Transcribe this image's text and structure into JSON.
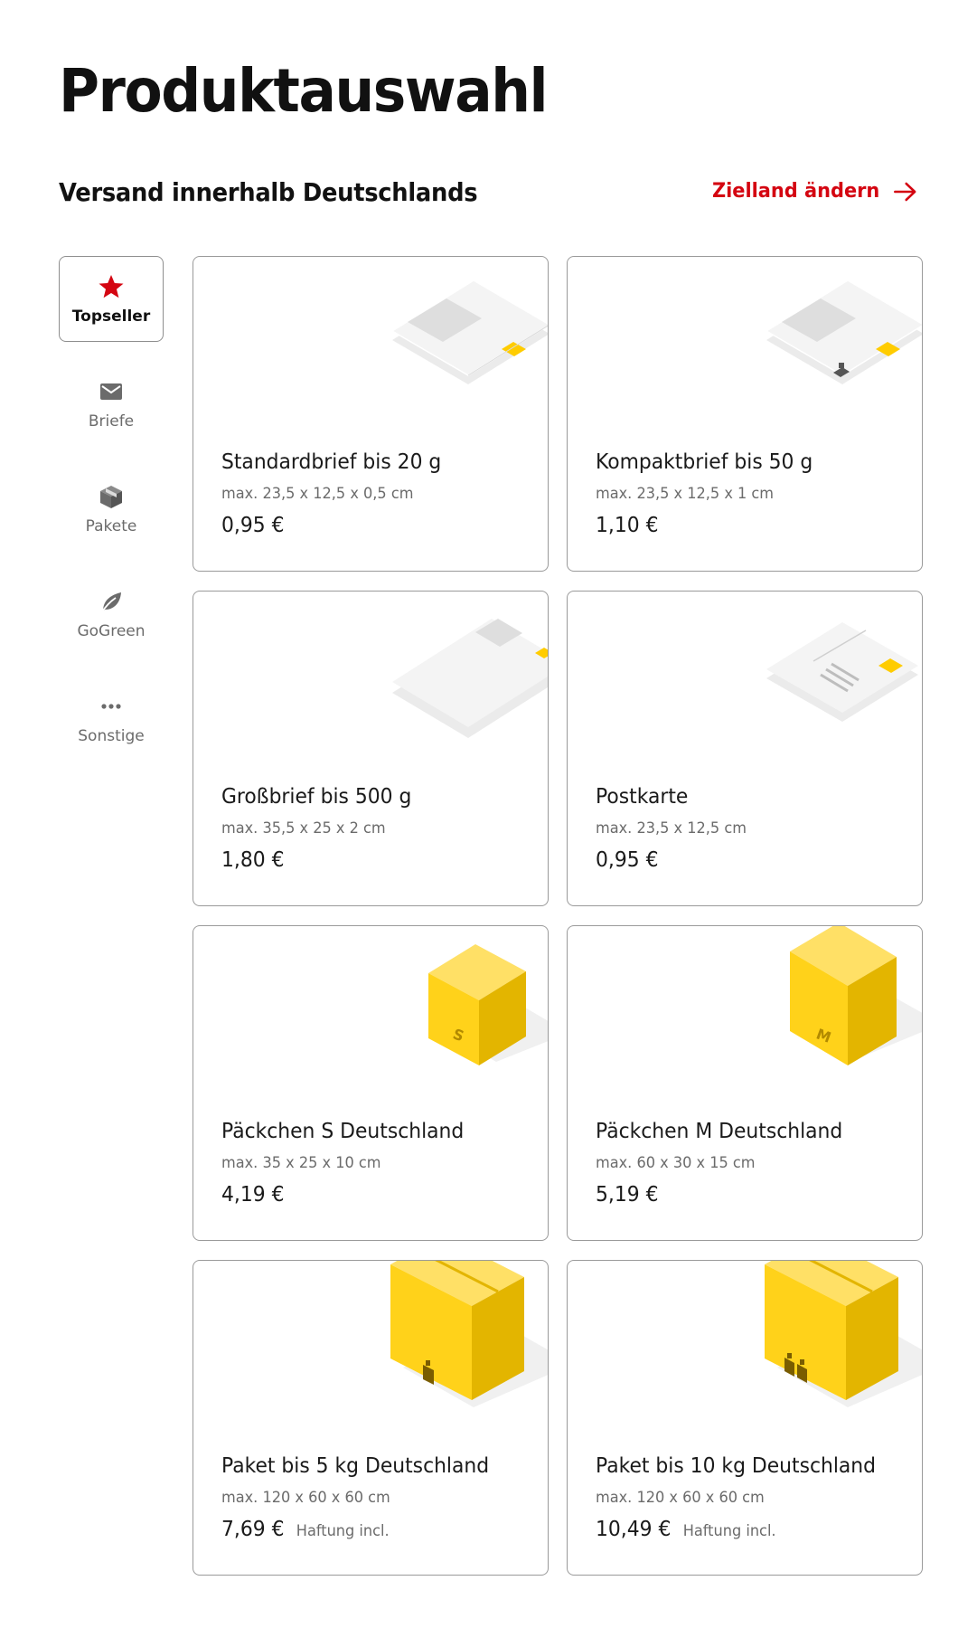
{
  "page": {
    "title": "Produktauswahl"
  },
  "section": {
    "title": "Versand innerhalb Deutschlands",
    "change_destination": "Zielland ändern"
  },
  "sidebar": {
    "items": [
      {
        "label": "Topseller",
        "icon": "star-icon",
        "active": true
      },
      {
        "label": "Briefe",
        "icon": "envelope-icon",
        "active": false
      },
      {
        "label": "Pakete",
        "icon": "package-icon",
        "active": false
      },
      {
        "label": "GoGreen",
        "icon": "leaf-icon",
        "active": false
      },
      {
        "label": "Sonstige",
        "icon": "more-icon",
        "active": false
      }
    ]
  },
  "products": [
    {
      "name": "Standardbrief bis 20 g",
      "dims": "max. 23,5 x 12,5 x 0,5 cm",
      "price": "0,95 €",
      "note": ""
    },
    {
      "name": "Kompaktbrief bis 50 g",
      "dims": "max. 23,5 x 12,5 x 1 cm",
      "price": "1,10 €",
      "note": ""
    },
    {
      "name": "Großbrief bis 500 g",
      "dims": "max. 35,5 x 25 x 2 cm",
      "price": "1,80 €",
      "note": ""
    },
    {
      "name": "Postkarte",
      "dims": "max. 23,5 x 12,5 cm",
      "price": "0,95 €",
      "note": ""
    },
    {
      "name": "Päckchen S Deutschland",
      "dims": "max. 35 x 25 x 10 cm",
      "price": "4,19 €",
      "note": ""
    },
    {
      "name": "Päckchen M Deutschland",
      "dims": "max. 60 x 30 x 15 cm",
      "price": "5,19 €",
      "note": ""
    },
    {
      "name": "Paket bis 5 kg Deutschland",
      "dims": "max. 120 x 60 x 60 cm",
      "price": "7,69 €",
      "note": "Haftung incl."
    },
    {
      "name": "Paket bis 10 kg Deutschland",
      "dims": "max. 120 x 60 x 60 cm",
      "price": "10,49 €",
      "note": "Haftung incl."
    }
  ],
  "box_labels": {
    "small": "S",
    "medium": "M"
  },
  "colors": {
    "accent_red": "#d40511",
    "dhl_yellow": "#ffcc00"
  }
}
